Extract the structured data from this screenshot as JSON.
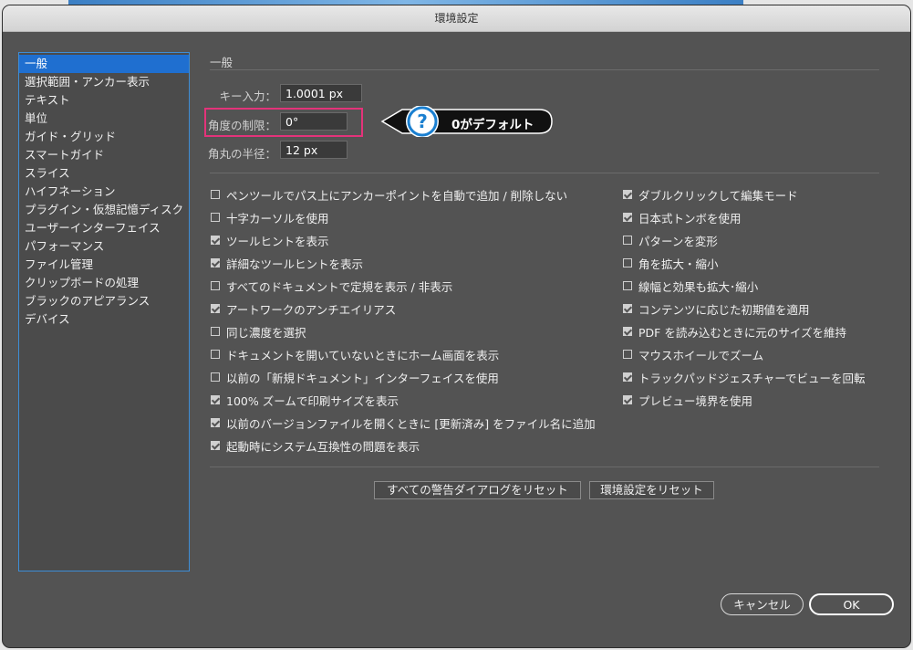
{
  "window": {
    "title": "環境設定"
  },
  "sidebar": {
    "items": [
      {
        "label": "一般",
        "active": true
      },
      {
        "label": "選択範囲・アンカー表示",
        "active": false
      },
      {
        "label": "テキスト",
        "active": false
      },
      {
        "label": "単位",
        "active": false
      },
      {
        "label": "ガイド・グリッド",
        "active": false
      },
      {
        "label": "スマートガイド",
        "active": false
      },
      {
        "label": "スライス",
        "active": false
      },
      {
        "label": "ハイフネーション",
        "active": false
      },
      {
        "label": "プラグイン・仮想記憶ディスク",
        "active": false
      },
      {
        "label": "ユーザーインターフェイス",
        "active": false
      },
      {
        "label": "パフォーマンス",
        "active": false
      },
      {
        "label": "ファイル管理",
        "active": false
      },
      {
        "label": "クリップボードの処理",
        "active": false
      },
      {
        "label": "ブラックのアピアランス",
        "active": false
      },
      {
        "label": "デバイス",
        "active": false
      }
    ]
  },
  "general": {
    "section_title": "一般",
    "keyboard_increment_label": "キー入力：",
    "keyboard_increment_value": "1.0001 px",
    "constrain_angle_label": "角度の制限：",
    "constrain_angle_value": "0°",
    "corner_radius_label": "角丸の半径：",
    "corner_radius_value": "12 px",
    "callout_text": "0がデフォルト",
    "callout_icon": "question-mark-icon",
    "highlight_color": "#e4337a",
    "callout_icon_color": "#1a7fd0"
  },
  "options_left": [
    {
      "label": "ペンツールでパス上にアンカーポイントを自動で追加 / 削除しない",
      "checked": false
    },
    {
      "label": "十字カーソルを使用",
      "checked": false
    },
    {
      "label": "ツールヒントを表示",
      "checked": true
    },
    {
      "label": "詳細なツールヒントを表示",
      "checked": true
    },
    {
      "label": "すべてのドキュメントで定規を表示 / 非表示",
      "checked": false
    },
    {
      "label": "アートワークのアンチエイリアス",
      "checked": true
    },
    {
      "label": "同じ濃度を選択",
      "checked": false
    },
    {
      "label": "ドキュメントを開いていないときにホーム画面を表示",
      "checked": false
    },
    {
      "label": "以前の「新規ドキュメント」インターフェイスを使用",
      "checked": false
    },
    {
      "label": "100% ズームで印刷サイズを表示",
      "checked": true
    },
    {
      "label": "以前のバージョンファイルを開くときに [更新済み] をファイル名に追加",
      "checked": true
    },
    {
      "label": "起動時にシステム互換性の問題を表示",
      "checked": true
    }
  ],
  "options_right": [
    {
      "label": "ダブルクリックして編集モード",
      "checked": true
    },
    {
      "label": "日本式トンボを使用",
      "checked": true
    },
    {
      "label": "パターンを変形",
      "checked": false
    },
    {
      "label": "角を拡大・縮小",
      "checked": false
    },
    {
      "label": "線幅と効果も拡大･縮小",
      "checked": false
    },
    {
      "label": "コンテンツに応じた初期値を適用",
      "checked": true
    },
    {
      "label": "PDF を読み込むときに元のサイズを維持",
      "checked": true
    },
    {
      "label": "マウスホイールでズーム",
      "checked": false
    },
    {
      "label": "トラックパッドジェスチャーでビューを回転",
      "checked": true
    },
    {
      "label": "プレビュー境界を使用",
      "checked": true
    }
  ],
  "buttons": {
    "reset_warnings": "すべての警告ダイアログをリセット",
    "reset_preferences": "環境設定をリセット",
    "cancel": "キャンセル",
    "ok": "OK"
  }
}
